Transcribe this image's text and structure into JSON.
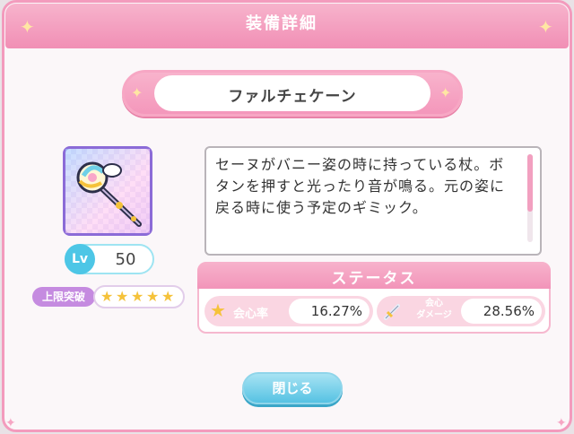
{
  "dialog": {
    "title": "装備詳細"
  },
  "item": {
    "name": "ファルチェケーン",
    "icon": "magic-cane-icon",
    "level_label": "Lv",
    "level": "50",
    "limit_break_label": "上限突破",
    "limit_break_stars": 5,
    "description": "セーヌがバニー姿の時に持っている杖。ボタンを押すと光ったり音が鳴る。元の姿に戻る時に使う予定のギミック。"
  },
  "status": {
    "title": "ステータス",
    "stats": [
      {
        "label": "会心率",
        "value": "16.27%",
        "icon": "star-icon"
      },
      {
        "label_line1": "会心",
        "label_line2": "ダメージ",
        "value": "28.56%",
        "icon": "sword-icon"
      }
    ]
  },
  "buttons": {
    "close_label": "閉じる"
  },
  "colors": {
    "accent_pink": "#f294b9",
    "button_blue": "#56c2e3",
    "level_badge": "#4dc6e6",
    "limit_break": "#c58be0",
    "star": "#f5c23a"
  }
}
